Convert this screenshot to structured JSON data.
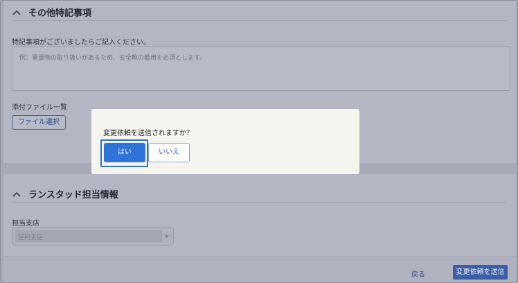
{
  "section_other": {
    "title": "その他特記事項",
    "notes_label": "特記事項がございましたらご記入ください。",
    "notes_placeholder": "例：重量物の取り扱いがあるため、安全靴の着用を必須とします。",
    "attachments_label": "添付ファイル一覧",
    "file_select_label": "ファイル選択"
  },
  "section_staff": {
    "title": "ランスタッド担当情報",
    "branch_label": "担当支店",
    "branch_value": "足利支店"
  },
  "footer": {
    "back_label": "戻る",
    "submit_label": "変更依頼を送信"
  },
  "modal": {
    "message": "変更依頼を送信されますか？",
    "yes_label": "はい",
    "no_label": "いいえ"
  },
  "colors": {
    "primary": "#2f74d8",
    "overlay": "#a8a9b6",
    "modal_bg": "#f5f4ef"
  },
  "icons": {
    "collapse": "chevron-up-icon",
    "dropdown": "caret-down-icon"
  }
}
